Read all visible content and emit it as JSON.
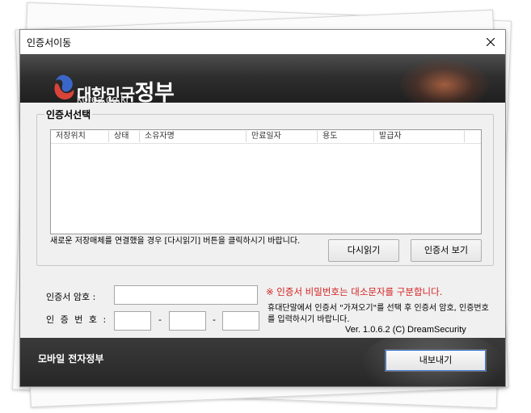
{
  "window": {
    "title": "인증서이동"
  },
  "banner": {
    "logo_main": "대한민국",
    "logo_big": "정부",
    "logo_sub": "korea.go.kr"
  },
  "cert_select": {
    "group_title": "인증서선택",
    "columns": [
      "저장위치",
      "상태",
      "소유자명",
      "만료일자",
      "용도",
      "발급자"
    ],
    "rows": [],
    "notice": "새로운 저장매체를 연결했을 경우 [다시읽기] 버튼을 클릭하시기 바랍니다.",
    "reload_label": "다시읽기",
    "view_label": "인증서 보기"
  },
  "form": {
    "password_label": "인증서 암호 :",
    "password_value": "",
    "number_label": "인 증 번 호 :",
    "number_values": [
      "",
      "",
      ""
    ],
    "dash": "-",
    "warning": "※ 인증서 비밀번호는 대소문자를 구분합니다.",
    "mobile_info": "휴대단말에서 인증서 \"가져오기\"를 선택 후 인증서 암호, 인증번호를 입력하시기 바랍니다.",
    "version": "Ver. 1.0.6.2  (C) DreamSecurity"
  },
  "footer": {
    "title": "모바일 전자정부",
    "export_label": "내보내기"
  },
  "colors": {
    "banner_dark": "#2f2f2f",
    "warning_red": "#d42020",
    "focus_blue": "#3d7bd9"
  }
}
